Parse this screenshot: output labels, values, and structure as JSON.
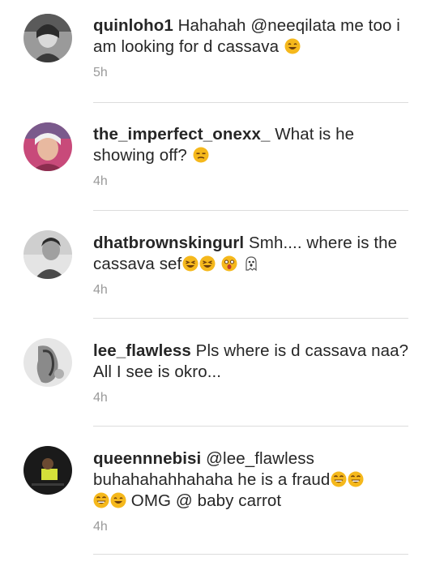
{
  "comments": [
    {
      "username": "quinloho1",
      "pre": " Hahahah ",
      "mention": "@neeqilata",
      "text": " me too i am looking for d cassava",
      "time": "5h"
    },
    {
      "username": "the_imperfect_onexx_",
      "text": " What is he showing off?",
      "time": "4h"
    },
    {
      "username": "dhatbrownskingurl",
      "text": " Smh.... where is the cassava sef",
      "time": "4h"
    },
    {
      "username": "lee_flawless",
      "text": " Pls where is d cassava naa? All I see is okro...",
      "time": "4h"
    },
    {
      "username": "queennnebisi",
      "mention": " @lee_flawless",
      "text": "buhahahahhahaha he is a fraud",
      "text2": " OMG @ baby carrot",
      "time": "4h"
    }
  ],
  "colors": {
    "text": "#262626",
    "timestamp": "#9a9a9a",
    "divider": "#dcdcdc",
    "emoji": "#f5b81c"
  },
  "icons": {
    "smile": "smiling-face-with-smiling-eyes-icon",
    "unamused": "unamused-face-icon",
    "laughing": "rolling-laughing-face-icon",
    "ghost": "ghost-icon",
    "grin": "grinning-face-icon"
  }
}
